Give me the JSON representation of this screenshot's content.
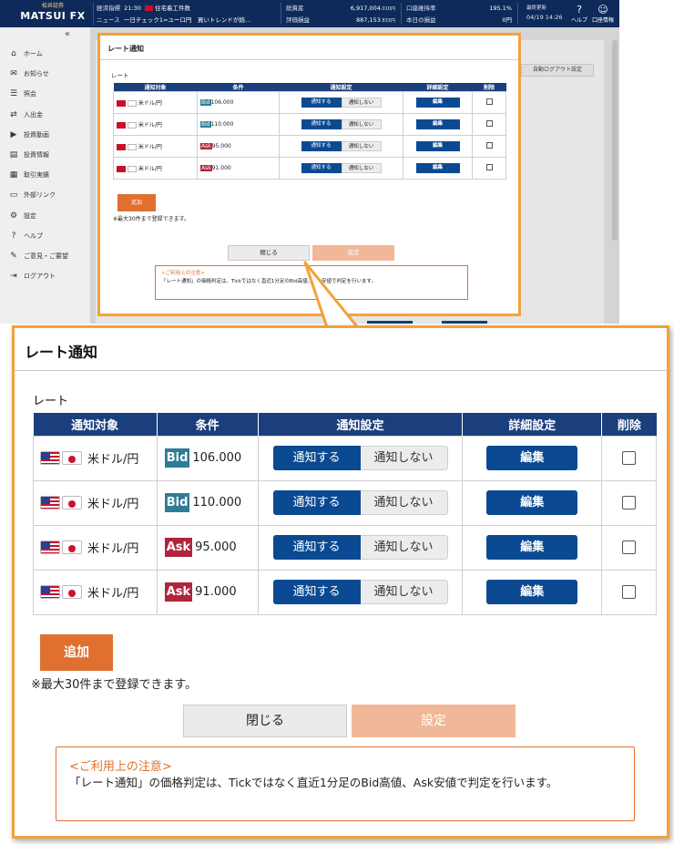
{
  "header": {
    "brand_sub": "松井証券",
    "brand_main": "MATSUI FX",
    "index_label": "経済指標",
    "index_time": "21:30",
    "index_name": "住宅着工件数",
    "news_label": "ニュース",
    "news_text": "一日チェック1=ユーロ円　買いトレンドが続…",
    "equity_label": "総資産",
    "equity_value": "6,917,004",
    "equity_unit": ".010円",
    "pl_label": "評価損益",
    "pl_value": "887,153",
    "pl_unit": ".833円",
    "margin_label": "口座維持率",
    "margin_value": "195.1%",
    "today_label": "本日の損益",
    "today_value": "0円",
    "updated_label": "最終更新",
    "updated_value": "04/19 14:26",
    "help_label": "ヘルプ",
    "account_label": "口座情報"
  },
  "sidebar": {
    "collapse": "«",
    "items": [
      {
        "icon": "⌂",
        "label": "ホーム"
      },
      {
        "icon": "✉",
        "label": "お知らせ"
      },
      {
        "icon": "☰",
        "label": "照会"
      },
      {
        "icon": "⇄",
        "label": "入出金"
      },
      {
        "icon": "▶",
        "label": "投資動画"
      },
      {
        "icon": "▤",
        "label": "投資情報"
      },
      {
        "icon": "▦",
        "label": "取引実績"
      },
      {
        "icon": "▭",
        "label": "外部リンク"
      },
      {
        "icon": "⚙",
        "label": "設定"
      },
      {
        "icon": "?",
        "label": "ヘルプ"
      },
      {
        "icon": "✎",
        "label": "ご意見・ご要望"
      },
      {
        "icon": "⇥",
        "label": "ログアウト"
      }
    ]
  },
  "background": {
    "auto_logout_tab": "自動ログアウト設定"
  },
  "dialog": {
    "title": "レート通知",
    "section": "レート",
    "columns": [
      "通知対象",
      "条件",
      "通知設定",
      "詳細設定",
      "削除"
    ],
    "rows": [
      {
        "pair": "米ドル/円",
        "side": "Bid",
        "value": "106.000",
        "on": "通知する",
        "off": "通知しない",
        "edit": "編集"
      },
      {
        "pair": "米ドル/円",
        "side": "Bid",
        "value": "110.000",
        "on": "通知する",
        "off": "通知しない",
        "edit": "編集"
      },
      {
        "pair": "米ドル/円",
        "side": "Ask",
        "value": "95.000",
        "on": "通知する",
        "off": "通知しない",
        "edit": "編集"
      },
      {
        "pair": "米ドル/円",
        "side": "Ask",
        "value": "91.000",
        "on": "通知する",
        "off": "通知しない",
        "edit": "編集"
      }
    ],
    "add_label": "追加",
    "limit_note": "※最大30件まで登録できます。",
    "close_label": "閉じる",
    "set_label": "設定",
    "caution_title": "<ご利用上の注意>",
    "caution_text": "「レート通知」の価格判定は、Tickではなく直近1分足のBid高値、Ask安値で判定を行います。"
  },
  "colors": {
    "navy": "#0e2a5a",
    "primary": "#0b4a92",
    "accent": "#f2a23a",
    "orange": "#e07030",
    "bid": "#2f7c96",
    "ask": "#b0253c"
  }
}
